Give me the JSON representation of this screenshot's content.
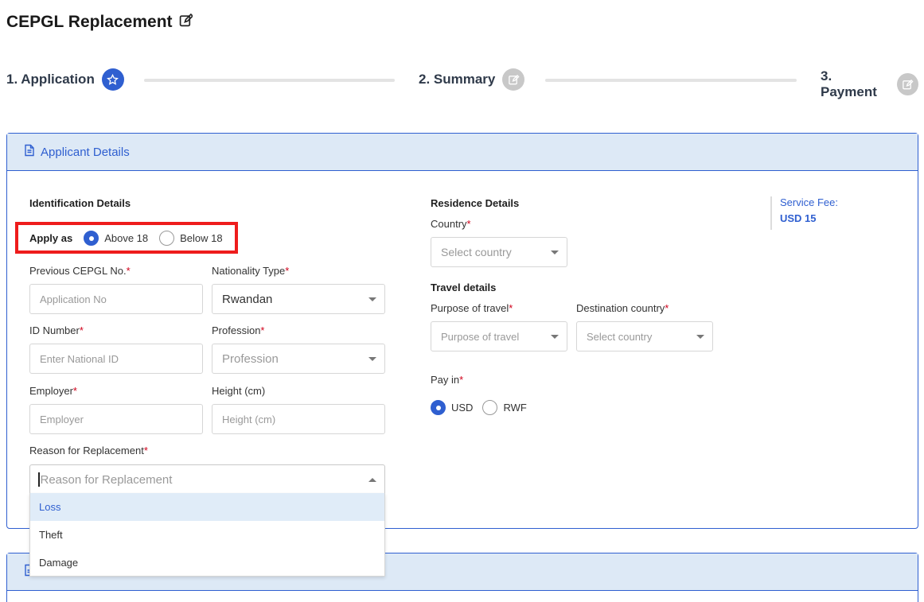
{
  "page": {
    "title": "CEPGL Replacement"
  },
  "stepper": {
    "steps": [
      {
        "label": "1. Application",
        "state": "active",
        "icon": "star-icon"
      },
      {
        "label": "2. Summary",
        "state": "inactive",
        "icon": "edit-icon"
      },
      {
        "label": "3. Payment",
        "state": "inactive",
        "icon": "edit-icon"
      }
    ]
  },
  "card": {
    "header": "Applicant Details"
  },
  "identification": {
    "title": "Identification Details",
    "apply_as_label": "Apply as",
    "apply_options": [
      "Above 18",
      "Below 18"
    ],
    "apply_selected": "Above 18"
  },
  "fields": {
    "previous_cepgl": {
      "label": "Previous CEPGL No.",
      "placeholder": "Application No"
    },
    "nationality_type": {
      "label": "Nationality Type",
      "value": "Rwandan"
    },
    "id_number": {
      "label": "ID Number",
      "placeholder": "Enter National ID"
    },
    "profession": {
      "label": "Profession",
      "placeholder": "Profession"
    },
    "employer": {
      "label": "Employer",
      "placeholder": "Employer"
    },
    "height": {
      "label": "Height (cm)",
      "placeholder": "Height (cm)"
    },
    "reason": {
      "label": "Reason for Replacement",
      "placeholder": "Reason for Replacement",
      "options": [
        "Loss",
        "Theft",
        "Damage"
      ],
      "highlighted": "Loss"
    }
  },
  "residence": {
    "title": "Residence Details",
    "country_label": "Country",
    "country_placeholder": "Select country"
  },
  "travel": {
    "title": "Travel details",
    "purpose_label": "Purpose of travel",
    "purpose_placeholder": "Purpose of travel",
    "destination_label": "Destination country",
    "destination_placeholder": "Select country"
  },
  "pay": {
    "label": "Pay in",
    "options": [
      "USD",
      "RWF"
    ],
    "selected": "USD"
  },
  "fee": {
    "label": "Service Fee:",
    "amount": "USD 15"
  },
  "colors": {
    "accent": "#2f5fd0",
    "header_bg": "#dde9f6",
    "highlight": "#ee1c1c",
    "required": "#d0021b"
  }
}
